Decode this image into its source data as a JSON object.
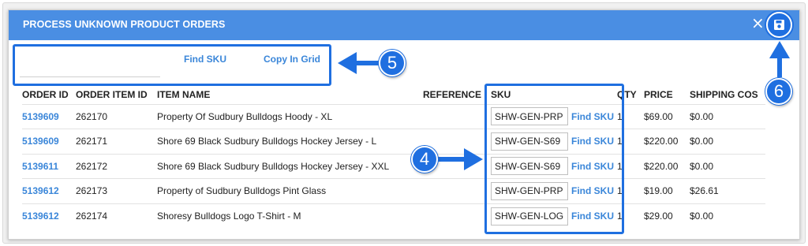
{
  "modal": {
    "title": "PROCESS UNKNOWN PRODUCT ORDERS",
    "close_symbol": "×"
  },
  "toolbar": {
    "find_sku_label": "Find SKU",
    "copy_in_grid_label": "Copy In Grid"
  },
  "columns": [
    "ORDER ID",
    "ORDER ITEM ID",
    "ITEM NAME",
    "REFERENCE",
    "SKU",
    "QTY",
    "PRICE",
    "SHIPPING COS"
  ],
  "rows": [
    {
      "order_id": "5139609",
      "order_item_id": "262170",
      "item_name": "Property Of Sudbury Bulldogs Hoody - XL",
      "sku": "SHW-GEN-PRP",
      "find_label": "Find SKU",
      "qty": "1",
      "price": "$69.00",
      "shipping": "$0.00"
    },
    {
      "order_id": "5139609",
      "order_item_id": "262171",
      "item_name": "Shore 69 Black Sudbury Bulldogs Hockey Jersey - L",
      "sku": "SHW-GEN-S69",
      "find_label": "Find SKU",
      "qty": "1",
      "price": "$220.00",
      "shipping": "$0.00"
    },
    {
      "order_id": "5139611",
      "order_item_id": "262172",
      "item_name": "Shore 69 Black Sudbury Bulldogs Hockey Jersey - XXL",
      "sku": "SHW-GEN-S69",
      "find_label": "Find SKU",
      "qty": "1",
      "price": "$220.00",
      "shipping": "$0.00"
    },
    {
      "order_id": "5139612",
      "order_item_id": "262173",
      "item_name": "Property of Sudbury Bulldogs Pint Glass",
      "sku": "SHW-GEN-PRP",
      "find_label": "Find SKU",
      "qty": "1",
      "price": "$19.00",
      "shipping": "$26.61"
    },
    {
      "order_id": "5139612",
      "order_item_id": "262174",
      "item_name": "Shoresy Bulldogs Logo T-Shirt - M",
      "sku": "SHW-GEN-LOG",
      "find_label": "Find SKU",
      "qty": "1",
      "price": "$29.00",
      "shipping": "$0.00"
    }
  ],
  "annotations": {
    "badge_4": "4",
    "badge_5": "5",
    "badge_6": "6"
  },
  "colors": {
    "header": "#4a8ee3",
    "link": "#3a86d9",
    "callout": "#1f6fe0"
  },
  "icons": {
    "close": "close-icon",
    "save": "save-icon"
  }
}
